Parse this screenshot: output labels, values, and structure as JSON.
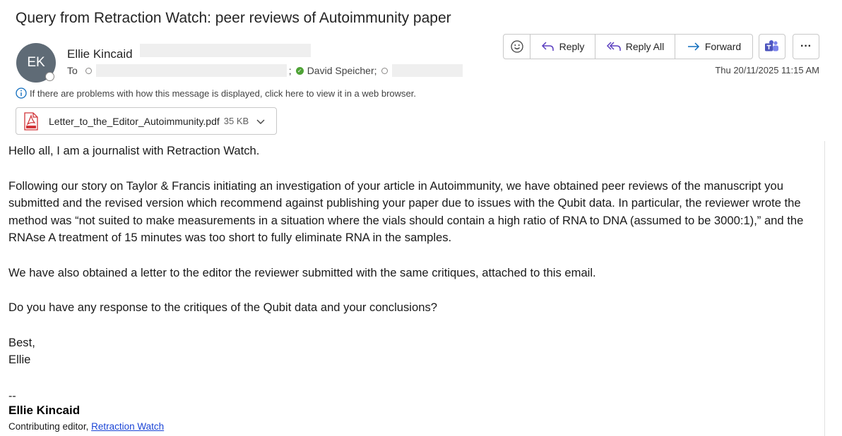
{
  "email": {
    "subject": "Query from Retraction Watch: peer reviews of Autoimmunity paper",
    "avatar_initials": "EK",
    "sender_name": "Ellie Kincaid",
    "to_label": "To",
    "recipient_named": "David Speicher;",
    "recipient_sep": ";",
    "date": "Thu 20/11/2025 11:15 AM",
    "info_text": "If there are problems with how this message is displayed, click here to view it in a web browser."
  },
  "toolbar": {
    "emoji_icon": "smiley-icon",
    "reply_label": "Reply",
    "reply_all_label": "Reply All",
    "forward_label": "Forward",
    "teams_icon": "teams-icon",
    "more_label": "···"
  },
  "attachment": {
    "name": "Letter_to_the_Editor_Autoimmunity.pdf",
    "size": "35 KB"
  },
  "body": {
    "p1": "Hello all, I am a journalist with Retraction Watch.",
    "p2": "Following our story on Taylor & Francis initiating an investigation of your article in Autoimmunity, we have obtained peer reviews of the manuscript you submitted and the revised version which recommend against publishing your paper due to issues with the Qubit data. In particular, the reviewer wrote the method was “not suited to make measurements in a situation where the vials should contain a high ratio of RNA to DNA (assumed to be 3000:1),” and the RNAse A treatment of 15 minutes was too short to fully eliminate RNA in the samples.",
    "p3": "We have also obtained a letter to the editor the reviewer submitted with the same critiques, attached to this email.",
    "p4": "Do you have any response to the critiques of the Qubit data and your conclusions?",
    "closing": "Best,",
    "closing_name": "Ellie"
  },
  "signature": {
    "dashes": "--",
    "name": "Ellie Kincaid",
    "role": "Contributing editor,",
    "link": "Retraction Watch"
  },
  "colors": {
    "avatar_bg": "#5f6b76",
    "accent": "#0f6cbd",
    "link": "#1a44d6",
    "presence_ok": "#4fa336",
    "pdf_red": "#d13438"
  }
}
